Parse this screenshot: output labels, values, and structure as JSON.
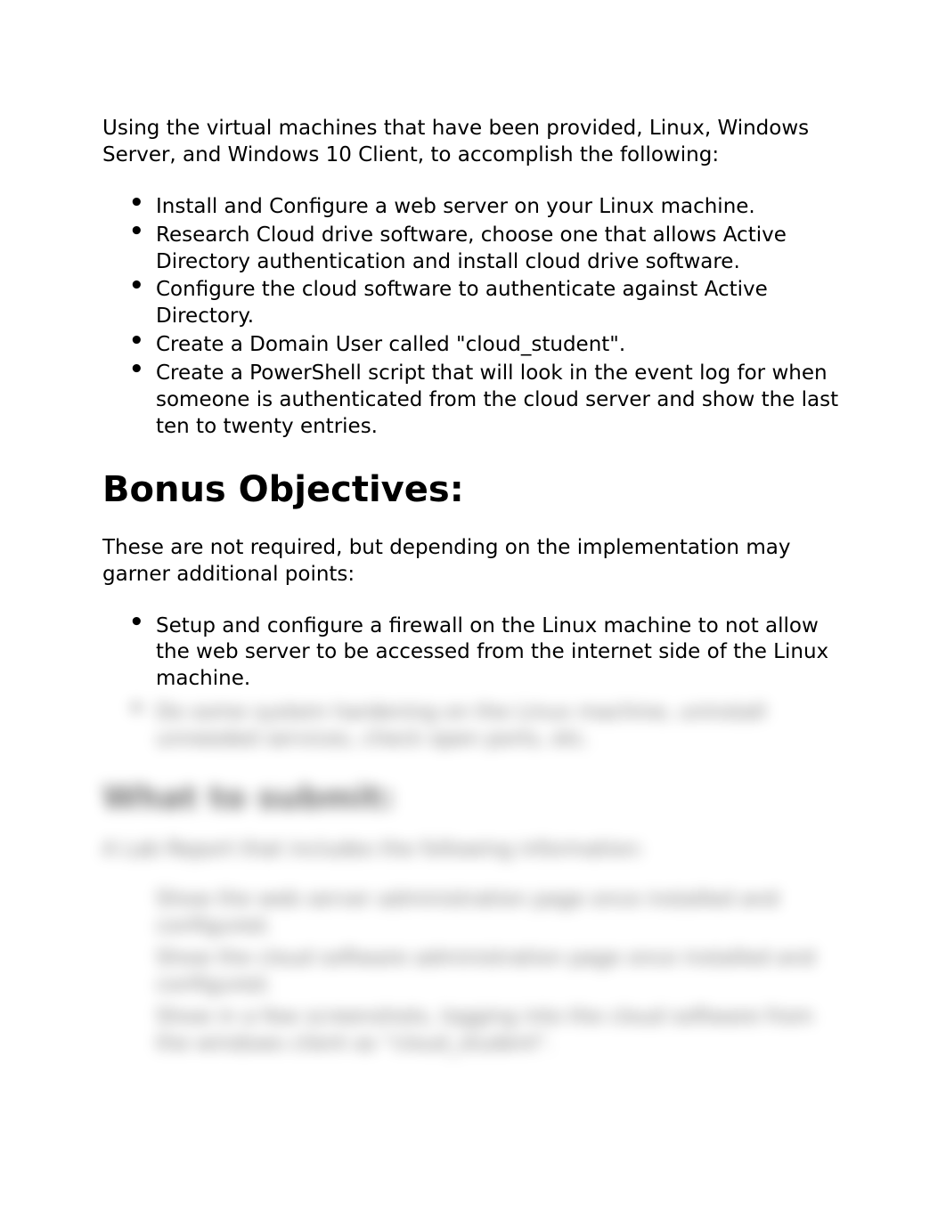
{
  "intro": "Using the virtual machines that have been provided, Linux, Windows Server, and Windows 10 Client, to accomplish the following:",
  "main_bullets": [
    "Install and Configure a web server on your Linux machine.",
    "Research Cloud drive software, choose one that allows Active Directory authentication and install cloud drive software.",
    "Configure the cloud software to authenticate against Active Directory.",
    "Create a Domain User called \"cloud_student\".",
    "Create a PowerShell script that will look in the event log for when someone is authenticated from the cloud server and show the last ten to twenty entries."
  ],
  "bonus_heading": "Bonus Objectives:",
  "bonus_intro": "These are not required, but depending on the implementation may garner additional points:",
  "bonus_bullets": [
    "Setup and configure a firewall on the Linux machine to not allow the web server to be accessed from the internet side of the Linux machine."
  ],
  "blurred": {
    "bullet2": "Do some system hardening on the Linux machine, uninstall unneeded services, check open ports, etc.",
    "heading": "What to submit:",
    "para": "A Lab Report that includes the following information:",
    "list": [
      "Show the web server administration page once installed and configured.",
      "Show the cloud software administration page once installed and configured.",
      "Show in a few screenshots, logging into the cloud software from the windows client as \"cloud_student\"."
    ]
  }
}
